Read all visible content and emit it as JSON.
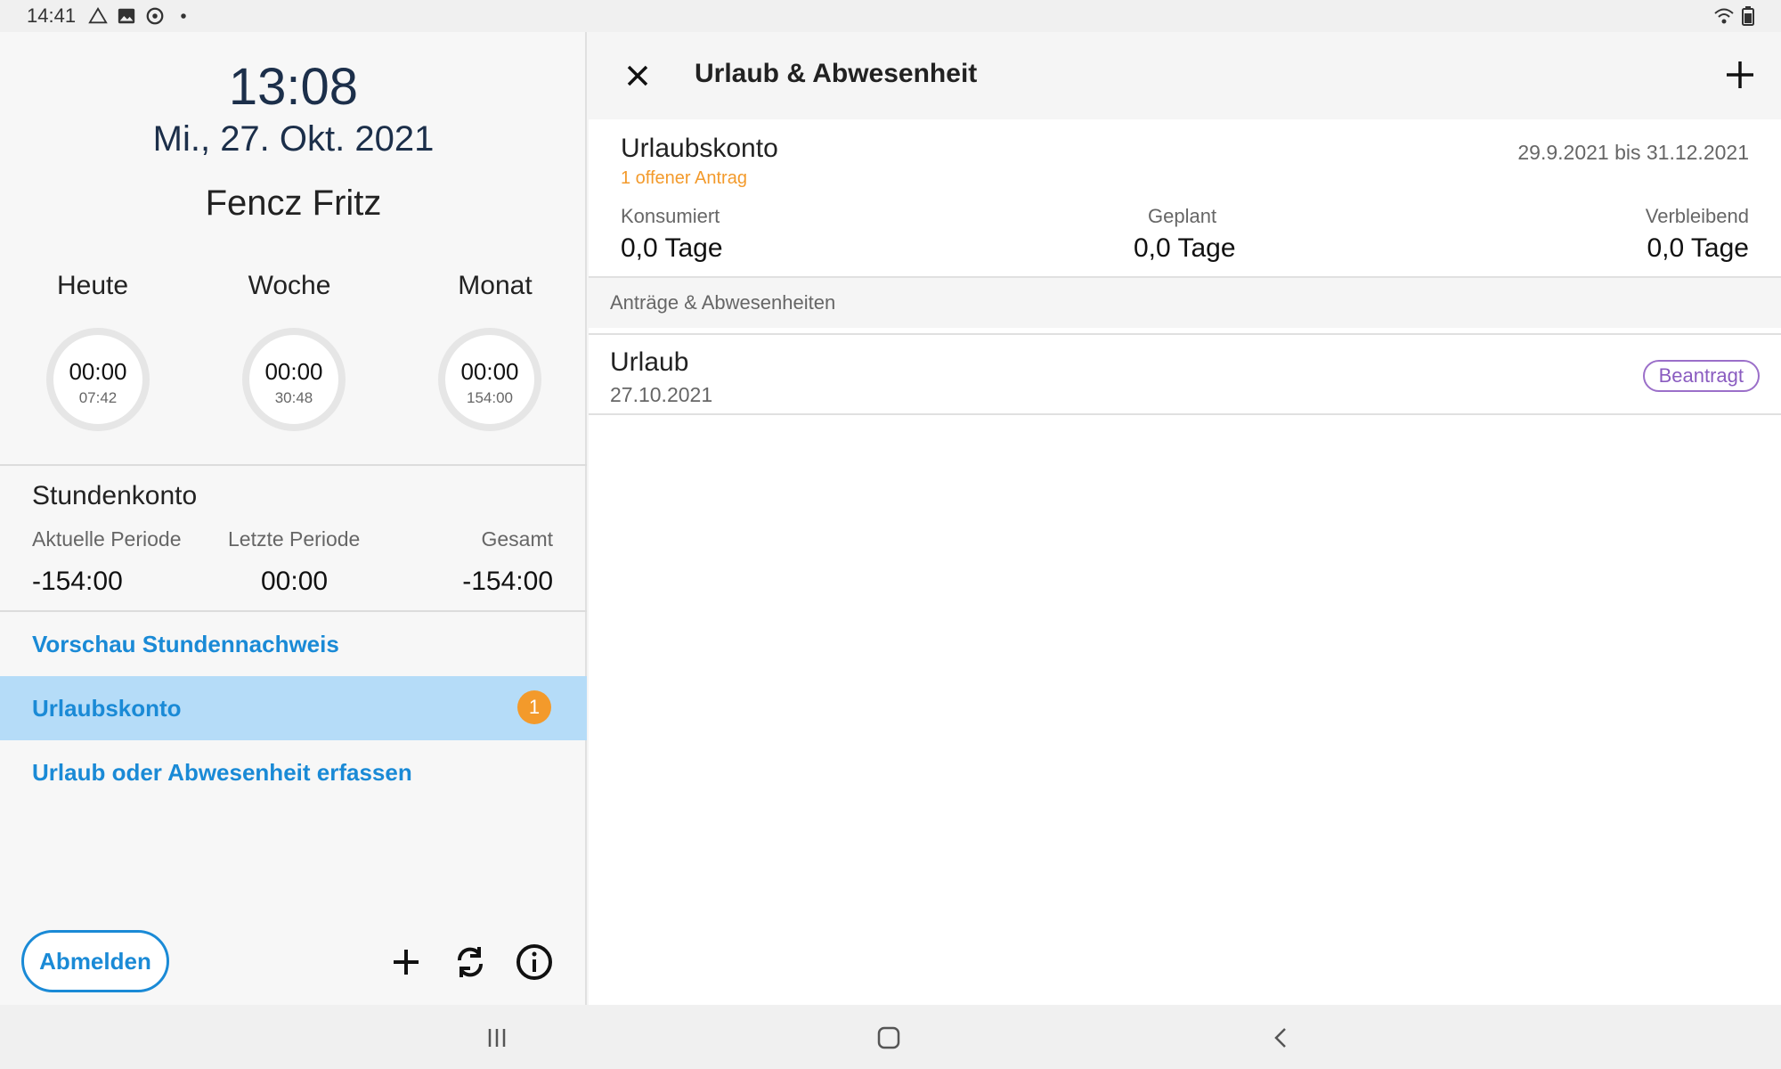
{
  "statusbar": {
    "time": "14:41"
  },
  "left": {
    "clock": "13:08",
    "date": "Mi., 27. Okt. 2021",
    "user": "Fencz Fritz",
    "periods": [
      {
        "label": "Heute",
        "value": "00:00",
        "target": "07:42"
      },
      {
        "label": "Woche",
        "value": "00:00",
        "target": "30:48"
      },
      {
        "label": "Monat",
        "value": "00:00",
        "target": "154:00"
      }
    ],
    "stundenkonto": {
      "title": "Stundenkonto",
      "cols": [
        {
          "label": "Aktuelle Periode",
          "value": "-154:00"
        },
        {
          "label": "Letzte Periode",
          "value": "00:00"
        },
        {
          "label": "Gesamt",
          "value": "-154:00"
        }
      ]
    },
    "nav": [
      {
        "label": "Vorschau Stundennachweis"
      },
      {
        "label": "Urlaubskonto",
        "badge": "1"
      },
      {
        "label": "Urlaub oder Abwesenheit erfassen"
      }
    ],
    "logout_label": "Abmelden"
  },
  "right": {
    "title": "Urlaub & Abwesenheit",
    "konto": {
      "title": "Urlaubskonto",
      "open_requests": "1 offener Antrag",
      "range": "29.9.2021 bis 31.12.2021",
      "cols": [
        {
          "label": "Konsumiert",
          "value": "0,0 Tage"
        },
        {
          "label": "Geplant",
          "value": "0,0 Tage"
        },
        {
          "label": "Verbleibend",
          "value": "0,0 Tage"
        }
      ]
    },
    "section_title": "Anträge & Abwesenheiten",
    "entries": [
      {
        "title": "Urlaub",
        "date": "27.10.2021",
        "status": "Beantragt"
      }
    ]
  },
  "colors": {
    "accent": "#1a8ad6",
    "badge": "#f39a2b",
    "status": "#8a5cc0",
    "active_row": "#b5dcf8"
  }
}
